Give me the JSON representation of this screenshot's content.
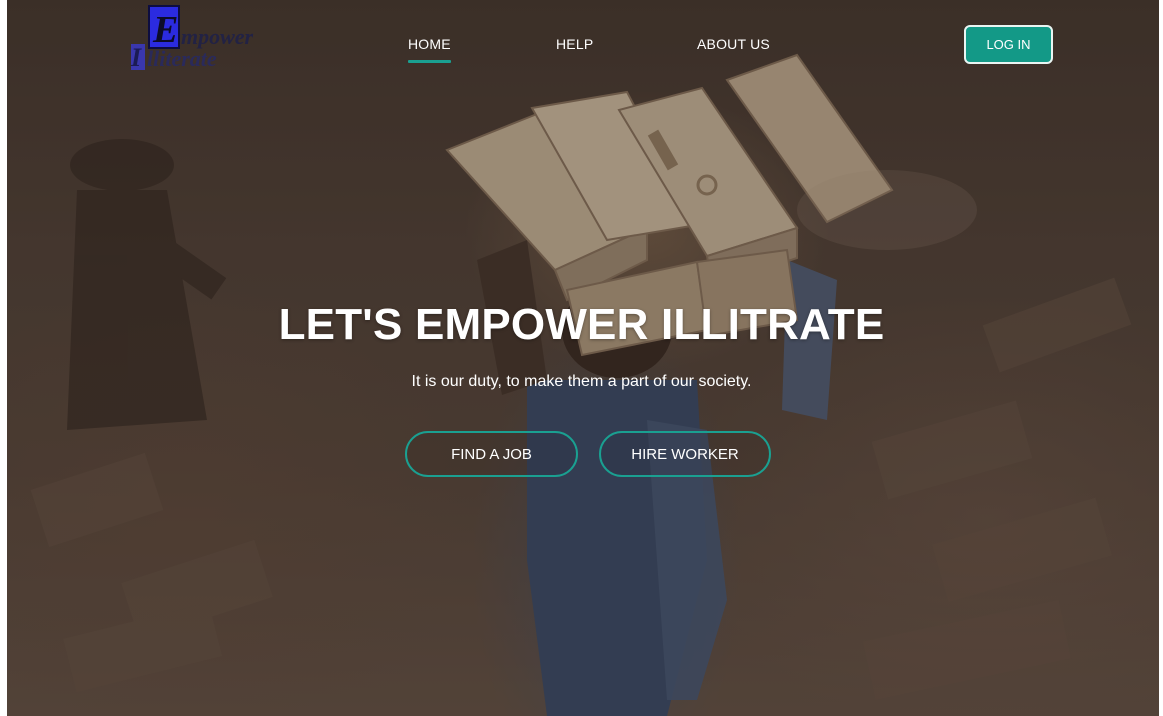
{
  "brand": {
    "logo_letter_e": "E",
    "logo_rest_line1": "mpower",
    "logo_letter_i": "I",
    "logo_rest_line2": "lliterate",
    "primary_color": "#2b2be0"
  },
  "nav": {
    "items": [
      {
        "label": "HOME",
        "active": true
      },
      {
        "label": "HELP",
        "active": false
      },
      {
        "label": "ABOUT US",
        "active": false
      }
    ],
    "login_label": "LOG IN",
    "accent_color": "#1aa091"
  },
  "hero": {
    "title": "LET'S EMPOWER ILLITRATE",
    "subtitle": "It is our duty, to make them a part of our society.",
    "buttons": [
      {
        "label": "FIND A JOB"
      },
      {
        "label": "HIRE WORKER"
      }
    ],
    "background_image": "worker carrying bricks"
  }
}
